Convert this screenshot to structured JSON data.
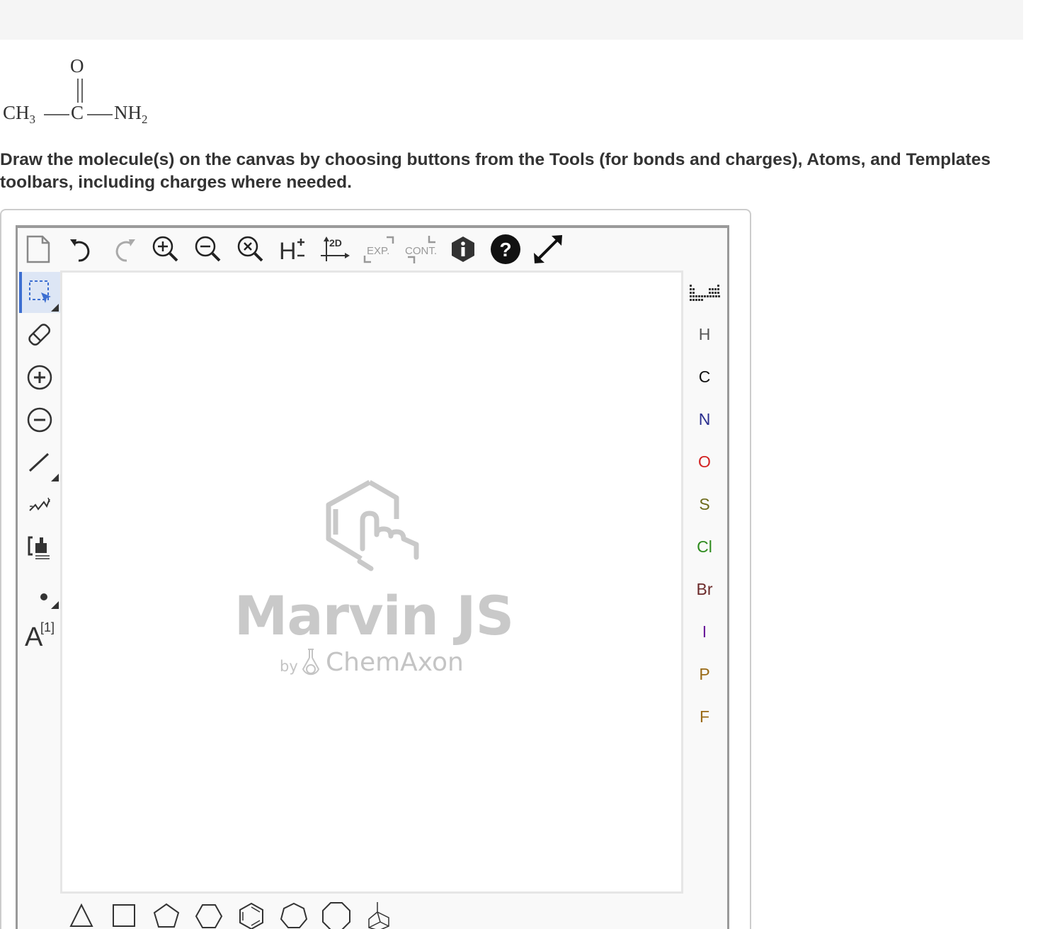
{
  "formula": {
    "o_label": "O",
    "ch3": "CH",
    "ch3_sub": "3",
    "c_label": "C",
    "nh2": "NH",
    "nh2_sub": "2"
  },
  "instructions": "Draw the molecule(s) on the canvas by choosing buttons from the Tools (for bonds and charges), Atoms, and Templates toolbars, including charges where needed.",
  "top_toolbar": [
    {
      "name": "new-document",
      "icon": "document-icon"
    },
    {
      "name": "undo",
      "icon": "undo-icon"
    },
    {
      "name": "redo",
      "icon": "redo-icon"
    },
    {
      "name": "zoom-in",
      "icon": "zoom-in-icon"
    },
    {
      "name": "zoom-out",
      "icon": "zoom-out-icon"
    },
    {
      "name": "zoom-reset",
      "icon": "zoom-reset-icon"
    },
    {
      "name": "hydrogens",
      "icon": "hydrogen-icon",
      "label": "H"
    },
    {
      "name": "clean-2d",
      "icon": "clean-2d-icon",
      "label": "2D"
    },
    {
      "name": "expand",
      "icon": "expand-icon",
      "label": "EXP."
    },
    {
      "name": "contract",
      "icon": "contract-icon",
      "label": "CONT."
    },
    {
      "name": "info",
      "icon": "info-icon"
    },
    {
      "name": "help",
      "icon": "help-icon"
    },
    {
      "name": "fullscreen",
      "icon": "fullscreen-icon"
    }
  ],
  "left_toolbar": [
    {
      "name": "select",
      "icon": "rectangle-select-icon",
      "active": true
    },
    {
      "name": "erase",
      "icon": "eraser-icon"
    },
    {
      "name": "positive-charge",
      "icon": "plus-charge-icon"
    },
    {
      "name": "negative-charge",
      "icon": "minus-charge-icon"
    },
    {
      "name": "single-bond",
      "icon": "single-bond-icon"
    },
    {
      "name": "chain",
      "icon": "chain-icon"
    },
    {
      "name": "bracket",
      "icon": "bracket-icon"
    },
    {
      "name": "radical",
      "icon": "dot-icon"
    },
    {
      "name": "atom-map",
      "icon": "atom-map-icon",
      "label": "A",
      "superscript": "[1]"
    }
  ],
  "canvas": {
    "watermark_title": "Marvin JS",
    "watermark_by": "by",
    "watermark_company": "ChemAxon"
  },
  "atoms": [
    {
      "symbol": "H",
      "color": "#555555"
    },
    {
      "symbol": "C",
      "color": "#111111"
    },
    {
      "symbol": "N",
      "color": "#2b2f8f"
    },
    {
      "symbol": "O",
      "color": "#d32222"
    },
    {
      "symbol": "S",
      "color": "#6d6a1a"
    },
    {
      "symbol": "Cl",
      "color": "#2e8b1e"
    },
    {
      "symbol": "Br",
      "color": "#6b2a2a"
    },
    {
      "symbol": "I",
      "color": "#6a1a9a"
    },
    {
      "symbol": "P",
      "color": "#9a6a16"
    },
    {
      "symbol": "F",
      "color": "#9a6a16"
    }
  ],
  "periodic_table_icon": "periodic-table-icon",
  "templates": [
    "triangle-icon",
    "square-icon",
    "pentagon-icon",
    "hexagon-icon",
    "benzene-icon",
    "heptagon-icon",
    "octagon-icon",
    "bicyclic-icon"
  ],
  "colors": {
    "active_tool": "#3d6fd1",
    "watermark": "#c9c9c9"
  }
}
